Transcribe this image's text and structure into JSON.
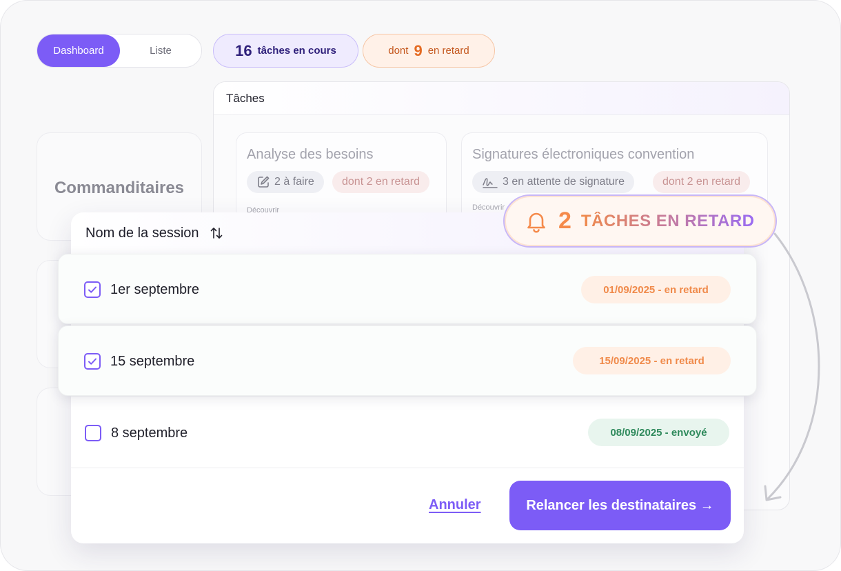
{
  "view_toggle": {
    "dashboard_label": "Dashboard",
    "list_label": "Liste"
  },
  "summary": {
    "in_progress_count": "16",
    "in_progress_label": "tâches en cours",
    "late_prefix": "dont",
    "late_count": "9",
    "late_label": "en retard"
  },
  "left_cards": {
    "commanditaires_title": "Commanditaires"
  },
  "tasks_panel": {
    "title": "Tâches",
    "cards": [
      {
        "title": "Analyse des besoins",
        "tag_label": "2 à faire",
        "tag_icon": "edit-icon",
        "late_label": "dont 2 en retard",
        "discover_label": "Découvrir"
      },
      {
        "title": "Signatures électroniques convention",
        "tag_label": "3 en attente de signature",
        "tag_icon": "signature-icon",
        "late_label": "dont 2 en retard",
        "discover_label": "Découvrir"
      }
    ]
  },
  "alert": {
    "count": "2",
    "label": "TÂCHES EN RETARD",
    "icon": "bell-icon"
  },
  "modal": {
    "column_header": "Nom de la session",
    "rows": [
      {
        "label": "1er septembre",
        "checked": true,
        "status": "01/09/2025 - en retard",
        "status_type": "late"
      },
      {
        "label": "15 septembre",
        "checked": true,
        "status": "15/09/2025 - en retard",
        "status_type": "late"
      },
      {
        "label": "8 septembre",
        "checked": false,
        "status": "08/09/2025 - envoyé",
        "status_type": "sent"
      }
    ],
    "cancel_label": "Annuler",
    "submit_label": "Relancer les destinataires →"
  },
  "colors": {
    "accent": "#7c5cf6",
    "late": "#f08a4a",
    "sent": "#2f8a5c"
  }
}
